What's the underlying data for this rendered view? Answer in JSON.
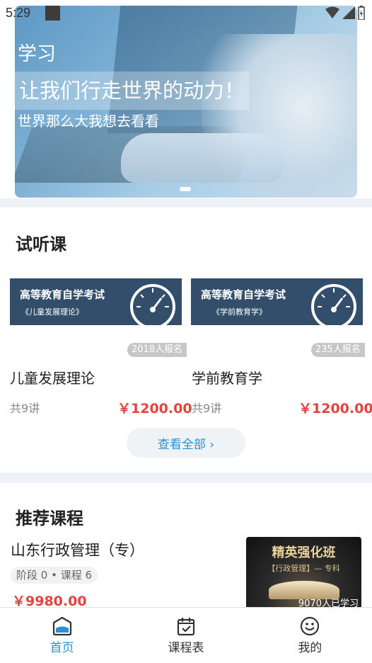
{
  "status_bar": {
    "time": "5:29"
  },
  "banner": {
    "line1": "学习",
    "line2": "让我们行走世界的动力！",
    "line3": "世界那么大我想去看看"
  },
  "trial": {
    "title": "试听课",
    "courses": [
      {
        "cover_title": "高等教育自学考试",
        "cover_sub": "《儿童发展理论》",
        "enrolled": "2018人报名",
        "name": "儿童发展理论",
        "lessons": "共9讲",
        "price": "￥1200.00"
      },
      {
        "cover_title": "高等教育自学考试",
        "cover_sub": "《学前教育学》",
        "enrolled": "235人报名",
        "name": "学前教育学",
        "lessons": "共9讲",
        "price": "￥1200.00"
      }
    ],
    "view_all": "查看全部 ›"
  },
  "recommended": {
    "title": "推荐课程",
    "item": {
      "name": "山东行政管理（专）",
      "tag": "阶段 0 • 课程 6",
      "price": "￥9980.00",
      "cover_title": "精英强化班",
      "cover_sub": "【行政管理】— 专科",
      "learners": "9070人已学习"
    }
  },
  "nav": [
    {
      "label": "首页",
      "icon": "home-icon",
      "active": true
    },
    {
      "label": "课程表",
      "icon": "calendar-icon",
      "active": false
    },
    {
      "label": "我的",
      "icon": "smiley-icon",
      "active": false
    }
  ],
  "colors": {
    "accent": "#2b8fd6",
    "price": "#e64340",
    "cover": "#324e6b"
  }
}
